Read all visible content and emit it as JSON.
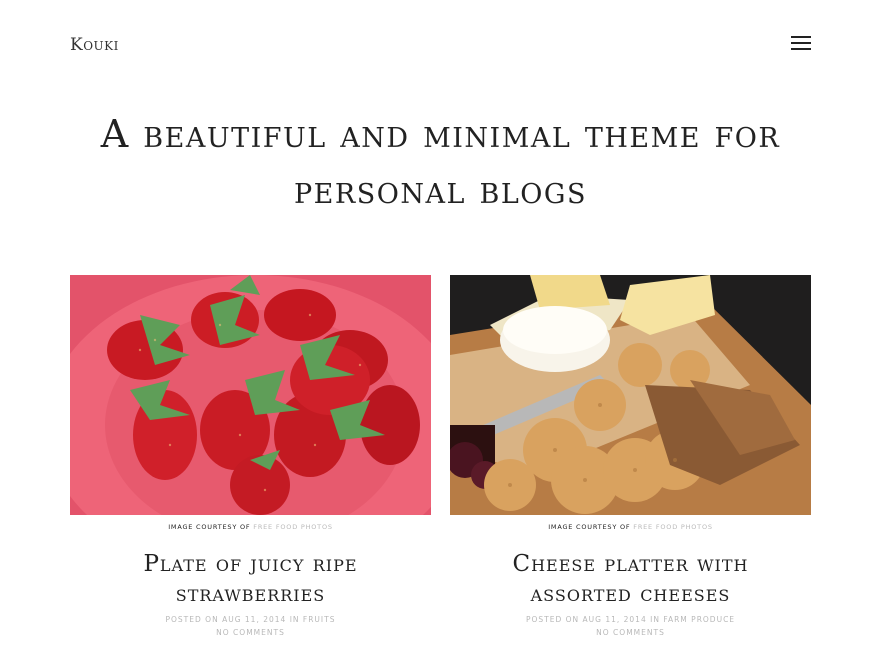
{
  "site": {
    "logo": "Kouki",
    "menu_icon": "hamburger-menu-icon"
  },
  "hero": {
    "tagline": "A beautiful and minimal theme for personal blogs"
  },
  "posts": [
    {
      "image": "strawberries-photo",
      "credit_prefix": "Image courtesy of",
      "credit_link": "Free Food Photos",
      "title": "Plate of juicy ripe strawberries",
      "posted_prefix": "Posted on",
      "date": "Aug 11, 2014",
      "in_word": "in",
      "category": "Fruits",
      "comments": "No Comments"
    },
    {
      "image": "cheese-platter-photo",
      "credit_prefix": "Image courtesy of",
      "credit_link": "Free Food Photos",
      "title": "Cheese platter with assorted cheeses",
      "posted_prefix": "Posted on",
      "date": "Aug 11, 2014",
      "in_word": "in",
      "category": "Farm Produce",
      "comments": "No Comments"
    }
  ],
  "colors": {
    "background": "#ffffff",
    "text": "#222222",
    "muted": "#b8b8b8"
  }
}
